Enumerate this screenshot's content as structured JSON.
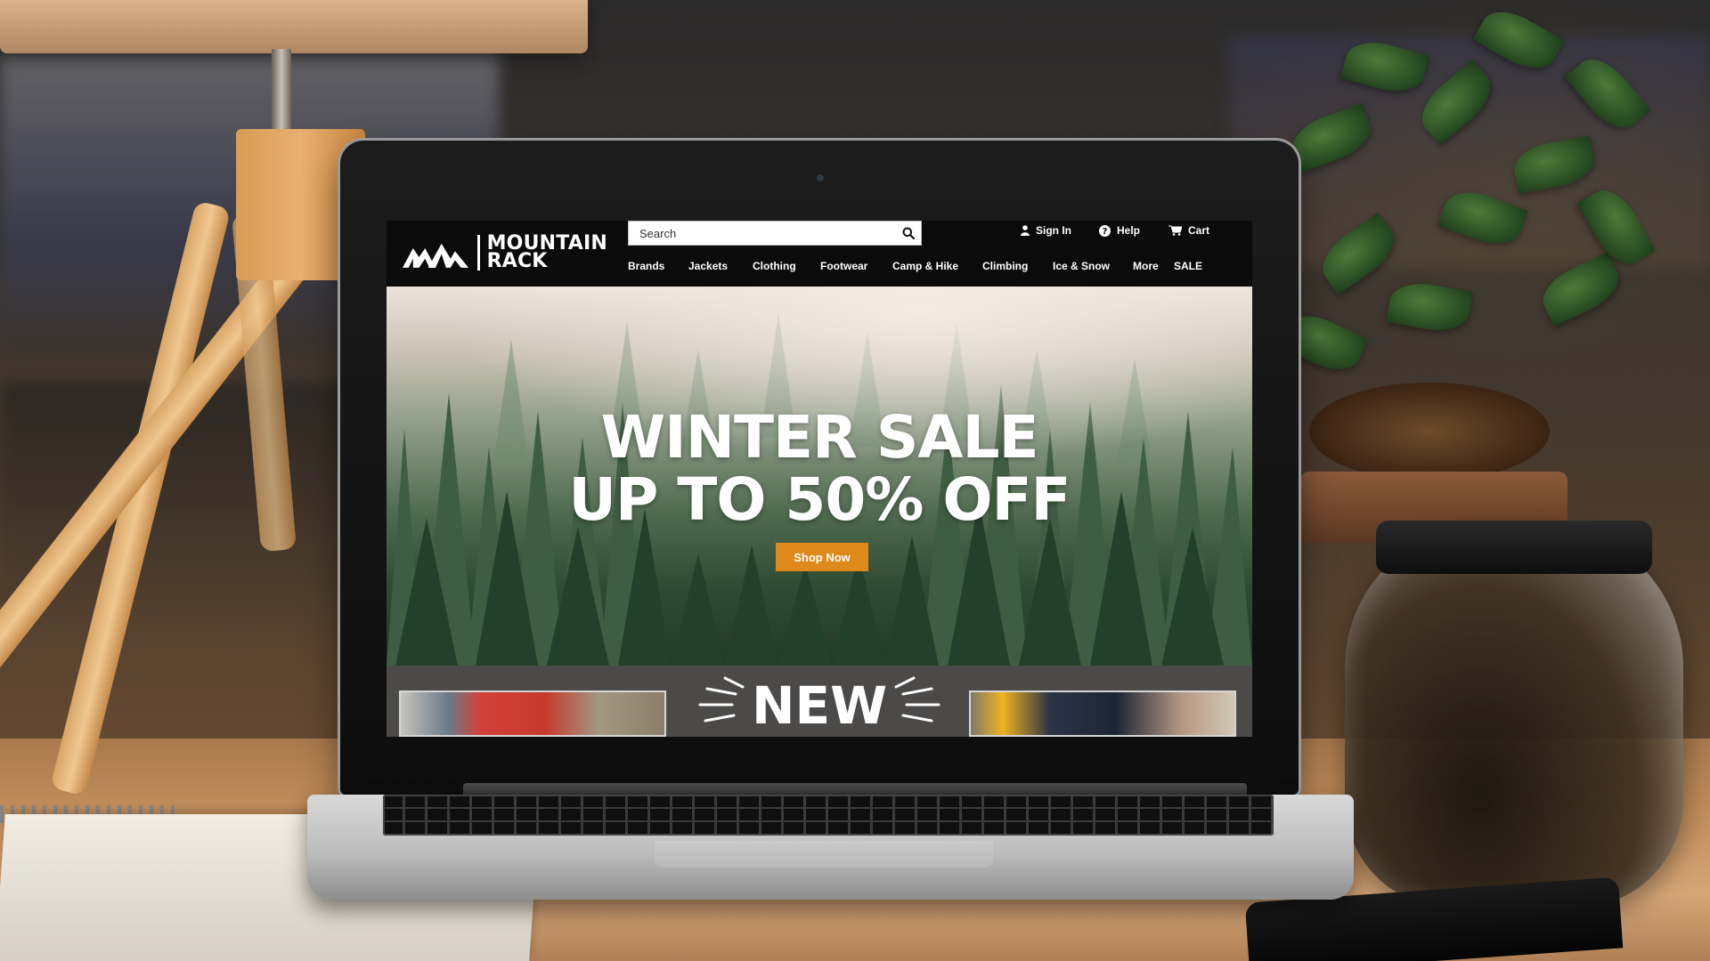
{
  "site": {
    "logo": {
      "line1": "MOUNTAIN",
      "line2": "RACK"
    },
    "search": {
      "placeholder": "Search"
    },
    "utility": {
      "sign_in": "Sign In",
      "help": "Help",
      "cart": "Cart"
    },
    "nav": [
      {
        "label": "Brands"
      },
      {
        "label": "Jackets"
      },
      {
        "label": "Clothing"
      },
      {
        "label": "Footwear"
      },
      {
        "label": "Camp & Hike"
      },
      {
        "label": "Climbing"
      },
      {
        "label": "Ice & Snow"
      },
      {
        "label": "More"
      },
      {
        "label": "SALE"
      }
    ],
    "hero": {
      "line1": "WINTER SALE",
      "line2": "UP TO 50% OFF",
      "cta": "Shop Now"
    },
    "new_section": {
      "badge": "NEW"
    }
  },
  "colors": {
    "accent": "#e0891b",
    "header_bg": "#0b0b0b",
    "strip_bg": "#4b4a48",
    "text_light": "#ffffff"
  },
  "icons": {
    "search": "search-icon",
    "sign_in": "user-icon",
    "help": "help-icon",
    "cart": "cart-icon"
  }
}
